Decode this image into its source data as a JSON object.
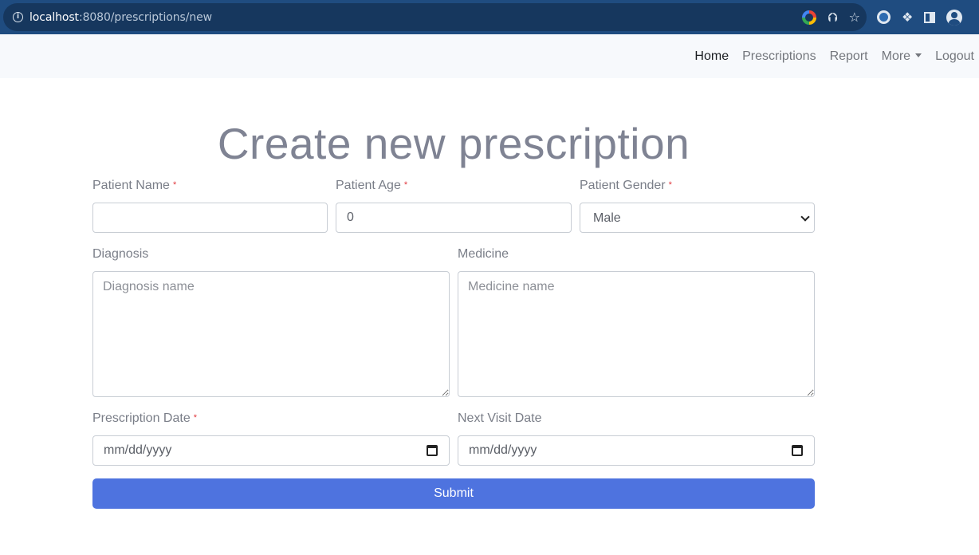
{
  "browser": {
    "url_host": "localhost",
    "url_rest": ":8080/prescriptions/new",
    "icons": [
      "info-icon",
      "google-icon",
      "share-icon",
      "star-icon",
      "extension-ring-icon",
      "puzzle-icon",
      "side-panel-icon",
      "profile-icon"
    ]
  },
  "nav": {
    "home": "Home",
    "prescriptions": "Prescriptions",
    "report": "Report",
    "more": "More",
    "logout": "Logout"
  },
  "form": {
    "title": "Create new prescription",
    "patient_name": {
      "label": "Patient Name",
      "required_mark": "*",
      "value": ""
    },
    "patient_age": {
      "label": "Patient Age",
      "required_mark": "*",
      "value": "0"
    },
    "patient_gender": {
      "label": "Patient Gender",
      "required_mark": "*",
      "value": "Male"
    },
    "diagnosis": {
      "label": "Diagnosis",
      "placeholder": "Diagnosis name"
    },
    "medicine": {
      "label": "Medicine",
      "placeholder": "Medicine name"
    },
    "prescription_date": {
      "label": "Prescription Date",
      "required_mark": "*",
      "placeholder": "mm/dd/yyyy"
    },
    "next_visit_date": {
      "label": "Next Visit Date",
      "placeholder": "mm/dd/yyyy"
    },
    "submit": "Submit"
  },
  "colors": {
    "chrome": "#1f4c80",
    "primary": "#4e73df",
    "required": "#e0383e"
  }
}
